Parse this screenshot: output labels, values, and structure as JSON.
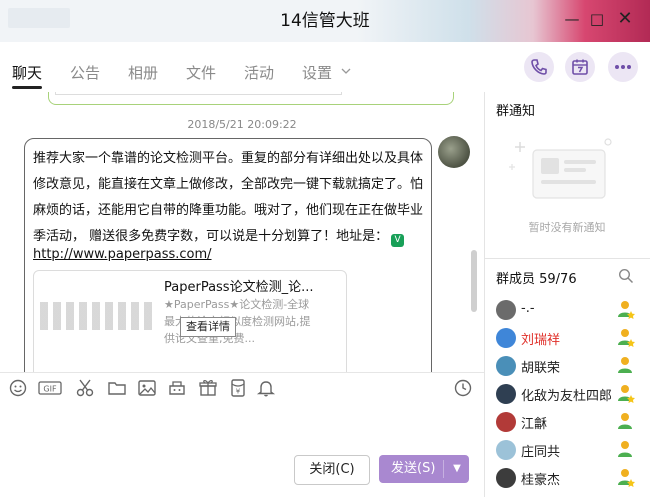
{
  "window": {
    "title": "14信管大班",
    "min_glyph": "—",
    "max_glyph": "□",
    "close_glyph": "✕"
  },
  "tabs": [
    {
      "label": "聊天"
    },
    {
      "label": "公告"
    },
    {
      "label": "相册"
    },
    {
      "label": "文件"
    },
    {
      "label": "活动"
    },
    {
      "label": "设置"
    }
  ],
  "chat": {
    "timestamp": "2018/5/21 20:09:22",
    "message_lines": [
      "推荐大家一个靠谱的论文检测平台。重复的部分有详细出处以及具体",
      "修改意见，能直接在文章上做修改，全部改完一键下载就搞定了。怕",
      "麻烦的话，还能用它自带的降重功能。哦对了，他们现在正在做毕业",
      "季活动， 赠送很多免费字数，可以说是十分划算了！地址是："
    ],
    "verified_glyph": "V",
    "link": "http://www.paperpass.com/",
    "card": {
      "title": "PaperPass论文检测_论...",
      "desc": "★PaperPass★论文检测-全球最大的论文相似度检测网站,提供论文查重,免费...",
      "tooltip": "查看详情"
    }
  },
  "composer": {
    "close_label": "关闭(C)",
    "send_label": "发送(S)",
    "send_arrow": "▼",
    "gif_label": "GIF"
  },
  "notice": {
    "title": "群通知",
    "empty_text": "暂时没有新通知"
  },
  "members": {
    "title": "群成员 59/76",
    "list": [
      {
        "name": "-.-",
        "highlight": false,
        "avatar_color": "#6b6b6b"
      },
      {
        "name": "刘瑞祥",
        "highlight": true,
        "avatar_color": "#3f86d8"
      },
      {
        "name": "胡联荣",
        "highlight": false,
        "avatar_color": "#4a8fb8"
      },
      {
        "name": "化敌为友杜四郎",
        "highlight": false,
        "avatar_color": "#2f3f52"
      },
      {
        "name": "江龢",
        "highlight": false,
        "avatar_color": "#b23a38"
      },
      {
        "name": "庄同共",
        "highlight": false,
        "avatar_color": "#9cc2d8"
      },
      {
        "name": "桂豪杰",
        "highlight": false,
        "avatar_color": "#3c3c3c"
      }
    ]
  },
  "colors": {
    "accent": "#a988d0",
    "tab_circle": "#ece6f4",
    "highlight_name": "#e0302a",
    "icon_purple": "#6f4fa8"
  }
}
